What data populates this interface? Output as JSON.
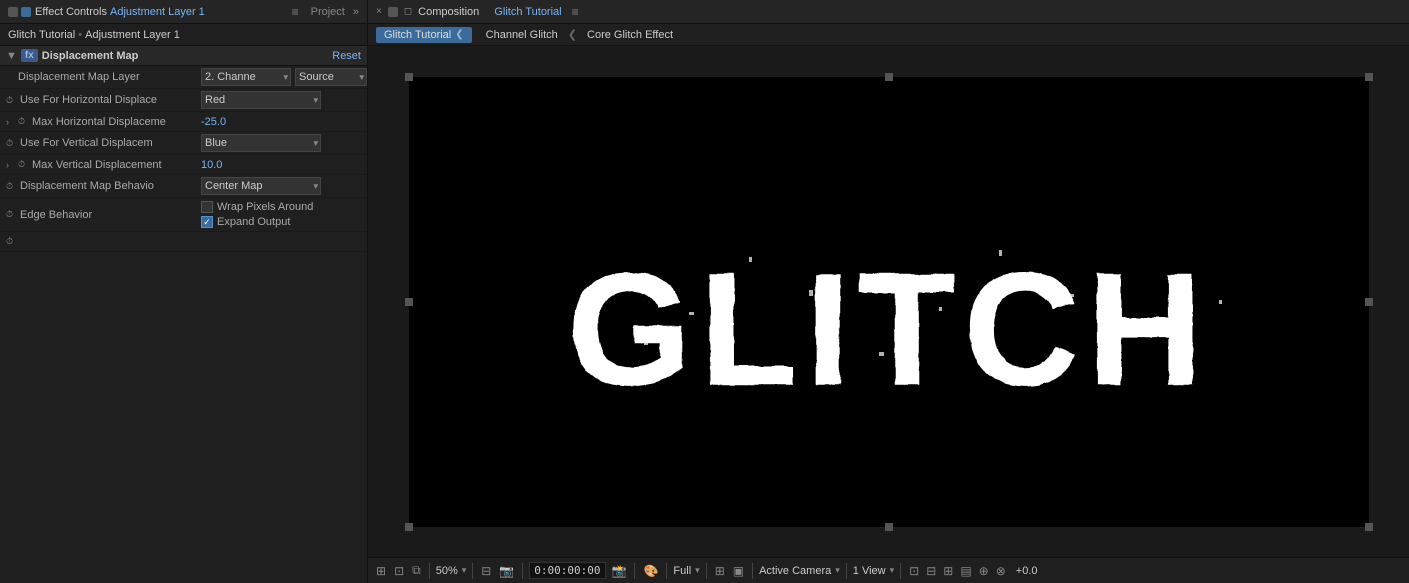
{
  "panels": {
    "effect_controls": {
      "tab_label": "Effect Controls",
      "tab_sublabel": "Adjustment Layer 1",
      "menu_icon": "≡",
      "project_label": "Project",
      "expand_icon": "»"
    },
    "composition": {
      "tab_close": "×",
      "tab_label": "Composition",
      "tab_name": "Glitch Tutorial",
      "menu_icon": "≡"
    }
  },
  "breadcrumbs": {
    "left": {
      "part1": "Glitch Tutorial",
      "sep": "•",
      "part2": "Adjustment Layer 1"
    },
    "right": {
      "active": "Glitch Tutorial",
      "sep1": "❮",
      "item2": "Channel Glitch",
      "sep2": "❮",
      "item3": "Core Glitch Effect"
    }
  },
  "effect": {
    "name": "Displacement Map",
    "reset_label": "Reset",
    "props": [
      {
        "id": "displacement_map_layer",
        "label": "Displacement Map Layer",
        "value_type": "dual_dropdown",
        "value1": "2. Channe",
        "value2": "Source"
      },
      {
        "id": "use_horizontal",
        "label": "Use For Horizontal Displace",
        "value_type": "dropdown",
        "value": "Red",
        "has_stopwatch": true
      },
      {
        "id": "max_horizontal",
        "label": "Max Horizontal Displaceme",
        "value_type": "number_blue",
        "value": "-25.0",
        "has_stopwatch": true,
        "has_expand": true
      },
      {
        "id": "use_vertical",
        "label": "Use For Vertical Displacem",
        "value_type": "dropdown",
        "value": "Blue",
        "has_stopwatch": true
      },
      {
        "id": "max_vertical",
        "label": "Max Vertical Displacement",
        "value_type": "number_blue",
        "value": "10.0",
        "has_stopwatch": true,
        "has_expand": true
      },
      {
        "id": "map_behavior",
        "label": "Displacement Map Behavio",
        "value_type": "dropdown",
        "value": "Center Map",
        "has_stopwatch": true
      }
    ],
    "edge_behavior": {
      "label": "Edge Behavior",
      "wrap_label": "Wrap Pixels Around",
      "wrap_checked": false,
      "expand_label": "Expand Output",
      "expand_checked": true
    }
  },
  "bottom_bar": {
    "zoom": "50%",
    "time": "0:00:00:00",
    "quality": "Full",
    "active_camera": "Active Camera",
    "view": "1 View",
    "offset": "+0.0"
  },
  "glitch_text": "GLITCH"
}
